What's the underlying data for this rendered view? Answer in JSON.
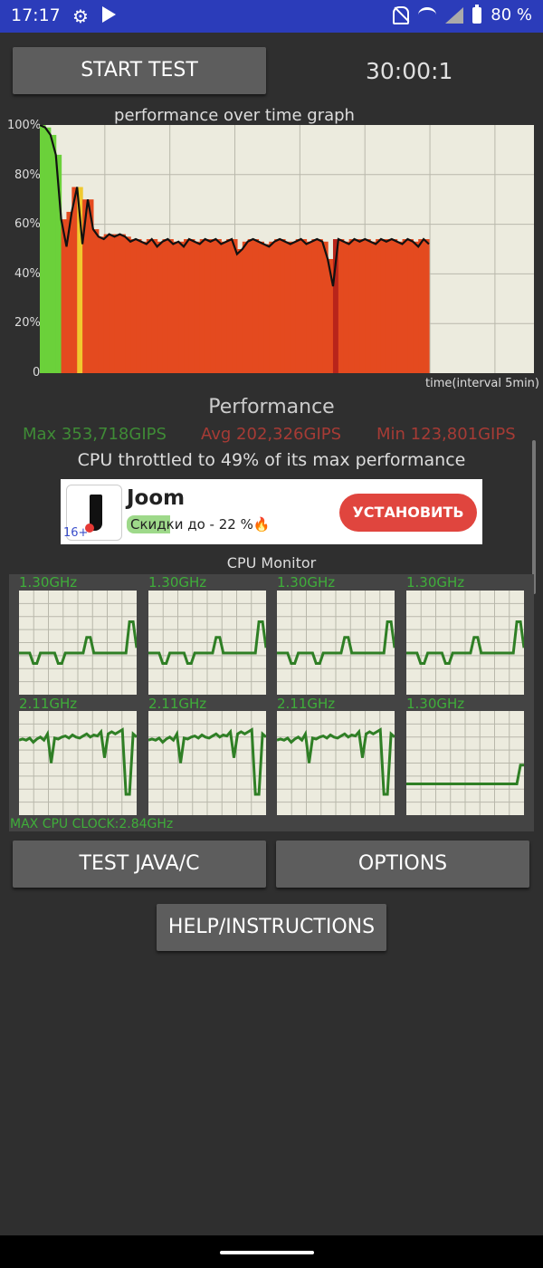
{
  "status_bar": {
    "time": "17:17",
    "battery": "80 %"
  },
  "controls": {
    "start_label": "START TEST",
    "timer": "30:00:1",
    "java_label": "TEST JAVA/C",
    "options_label": "OPTIONS",
    "help_label": "HELP/INSTRUCTIONS"
  },
  "graph": {
    "title": "performance over time graph",
    "y_ticks": [
      "100%",
      "80%",
      "60%",
      "40%",
      "20%",
      "0"
    ],
    "x_label": "time(interval 5min)"
  },
  "chart_data": {
    "type": "line",
    "title": "performance over time graph",
    "xlabel": "time(interval 5min)",
    "ylabel": "",
    "ylim": [
      0,
      100
    ],
    "series": [
      {
        "values": [
          100,
          99,
          96,
          88,
          62,
          51,
          65,
          75,
          52,
          70,
          58,
          55,
          54,
          56,
          55,
          56,
          55,
          53,
          54,
          53,
          52,
          54,
          51,
          53,
          54,
          52,
          53,
          51,
          54,
          53,
          52,
          54,
          53,
          54,
          52,
          53,
          54,
          48,
          50,
          53,
          54,
          53,
          52,
          51,
          53,
          54,
          53,
          52,
          53,
          54,
          52,
          53,
          54,
          53,
          46,
          35,
          54,
          53,
          52,
          54,
          53,
          54,
          53,
          52,
          54,
          53,
          54,
          53,
          52,
          54,
          53,
          51,
          54,
          52
        ]
      }
    ]
  },
  "performance": {
    "heading": "Performance",
    "max": "Max 353,718GIPS",
    "avg": "Avg 202,326GIPS",
    "min": "Min 123,801GIPS",
    "throttle": "CPU throttled to 49% of its max performance"
  },
  "ad": {
    "name": "Joom",
    "promo": "Скидки до - 22 %🔥",
    "age": "16+",
    "button": "УСТАНОВИТЬ"
  },
  "cpu_monitor": {
    "title": "CPU Monitor",
    "max_clock": "MAX CPU CLOCK:2.84GHz",
    "cores": [
      {
        "freq": "1.30GHz",
        "levels": [
          0.4,
          0.4,
          0.4,
          0.4,
          0.3,
          0.3,
          0.4,
          0.4,
          0.4,
          0.4,
          0.4,
          0.3,
          0.3,
          0.4,
          0.4,
          0.4,
          0.4,
          0.4,
          0.4,
          0.55,
          0.55,
          0.4,
          0.4,
          0.4,
          0.4,
          0.4,
          0.4,
          0.4,
          0.4,
          0.4,
          0.4,
          0.7,
          0.7,
          0.45
        ]
      },
      {
        "freq": "1.30GHz",
        "levels": [
          0.4,
          0.4,
          0.4,
          0.4,
          0.3,
          0.3,
          0.4,
          0.4,
          0.4,
          0.4,
          0.4,
          0.3,
          0.3,
          0.4,
          0.4,
          0.4,
          0.4,
          0.4,
          0.4,
          0.55,
          0.55,
          0.4,
          0.4,
          0.4,
          0.4,
          0.4,
          0.4,
          0.4,
          0.4,
          0.4,
          0.4,
          0.7,
          0.7,
          0.45
        ]
      },
      {
        "freq": "1.30GHz",
        "levels": [
          0.4,
          0.4,
          0.4,
          0.4,
          0.3,
          0.3,
          0.4,
          0.4,
          0.4,
          0.4,
          0.4,
          0.3,
          0.3,
          0.4,
          0.4,
          0.4,
          0.4,
          0.4,
          0.4,
          0.55,
          0.55,
          0.4,
          0.4,
          0.4,
          0.4,
          0.4,
          0.4,
          0.4,
          0.4,
          0.4,
          0.4,
          0.7,
          0.7,
          0.45
        ]
      },
      {
        "freq": "1.30GHz",
        "levels": [
          0.4,
          0.4,
          0.4,
          0.4,
          0.3,
          0.3,
          0.4,
          0.4,
          0.4,
          0.4,
          0.4,
          0.3,
          0.3,
          0.4,
          0.4,
          0.4,
          0.4,
          0.4,
          0.4,
          0.55,
          0.55,
          0.4,
          0.4,
          0.4,
          0.4,
          0.4,
          0.4,
          0.4,
          0.4,
          0.4,
          0.4,
          0.7,
          0.7,
          0.45
        ]
      },
      {
        "freq": "2.11GHz",
        "levels": [
          0.72,
          0.73,
          0.72,
          0.74,
          0.7,
          0.73,
          0.75,
          0.72,
          0.78,
          0.5,
          0.74,
          0.73,
          0.75,
          0.76,
          0.74,
          0.77,
          0.75,
          0.74,
          0.76,
          0.78,
          0.75,
          0.77,
          0.76,
          0.8,
          0.55,
          0.78,
          0.8,
          0.78,
          0.8,
          0.82,
          0.2,
          0.2,
          0.78,
          0.75
        ]
      },
      {
        "freq": "2.11GHz",
        "levels": [
          0.72,
          0.73,
          0.72,
          0.74,
          0.7,
          0.73,
          0.75,
          0.72,
          0.78,
          0.5,
          0.74,
          0.73,
          0.75,
          0.76,
          0.74,
          0.77,
          0.75,
          0.74,
          0.76,
          0.78,
          0.75,
          0.77,
          0.76,
          0.8,
          0.55,
          0.78,
          0.8,
          0.78,
          0.8,
          0.82,
          0.2,
          0.2,
          0.78,
          0.75
        ]
      },
      {
        "freq": "2.11GHz",
        "levels": [
          0.72,
          0.73,
          0.72,
          0.74,
          0.7,
          0.73,
          0.75,
          0.72,
          0.78,
          0.5,
          0.74,
          0.73,
          0.75,
          0.76,
          0.74,
          0.77,
          0.75,
          0.74,
          0.76,
          0.78,
          0.75,
          0.77,
          0.76,
          0.8,
          0.55,
          0.78,
          0.8,
          0.78,
          0.8,
          0.82,
          0.2,
          0.2,
          0.78,
          0.75
        ]
      },
      {
        "freq": "1.30GHz",
        "levels": [
          0.3,
          0.3,
          0.3,
          0.3,
          0.3,
          0.3,
          0.3,
          0.3,
          0.3,
          0.3,
          0.3,
          0.3,
          0.3,
          0.3,
          0.3,
          0.3,
          0.3,
          0.3,
          0.3,
          0.3,
          0.3,
          0.3,
          0.3,
          0.3,
          0.3,
          0.3,
          0.3,
          0.3,
          0.3,
          0.3,
          0.3,
          0.3,
          0.48,
          0.48
        ]
      }
    ]
  },
  "colors": {
    "status_bar": "#2b3cba",
    "background": "#2f2f2f",
    "button": "#5d5d5d",
    "graph_bg": "#ecebde",
    "perf_line": "#111111",
    "fill_high": "#6bd13a",
    "fill_mid": "#f0c92e",
    "fill_low": "#e44a1f",
    "core_line": "#2f7f25",
    "green_text": "#3f8b36",
    "red_text": "#a63b35"
  }
}
